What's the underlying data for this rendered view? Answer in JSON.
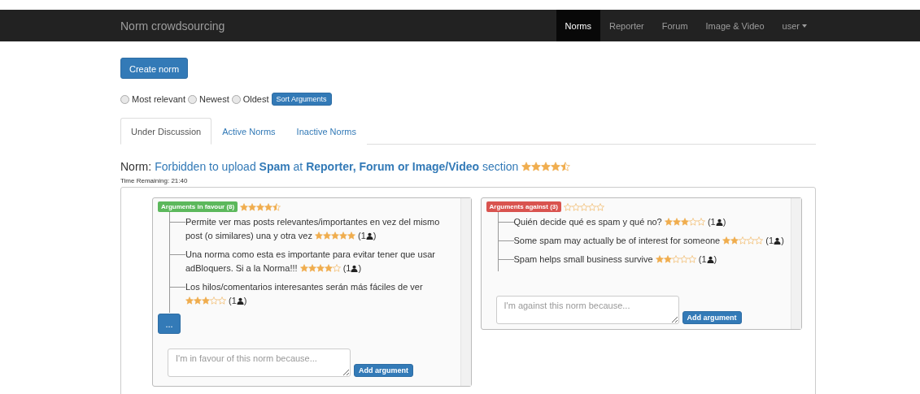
{
  "navbar": {
    "brand": "Norm crowdsourcing",
    "items": [
      {
        "label": "Norms",
        "selected": true
      },
      {
        "label": "Reporter",
        "selected": false
      },
      {
        "label": "Forum",
        "selected": false
      },
      {
        "label": "Image & Video",
        "selected": false
      }
    ],
    "user": "user"
  },
  "create_button": "Create norm",
  "sort": {
    "options": [
      {
        "label": "Most relevant",
        "selected": false
      },
      {
        "label": "Newest",
        "selected": false
      },
      {
        "label": "Oldest",
        "selected": false
      }
    ],
    "button": "Sort Arguments"
  },
  "tabs": [
    {
      "label": "Under Discussion",
      "selected": true
    },
    {
      "label": "Active Norms",
      "selected": false
    },
    {
      "label": "Inactive Norms",
      "selected": false
    }
  ],
  "norm": {
    "prefix": "Norm:",
    "title": "Forbidden to upload **Spam** at **Reporter, Forum or Image/Video** section",
    "stars": 4.5,
    "time_remaining": "Time Remaining: 21:40"
  },
  "columns": [
    {
      "kind": "favour",
      "badge": "Arguments in favour (8)",
      "stars": 4.5,
      "arguments": [
        {
          "text": "Permite ver mas posts relevantes/importantes en vez del mismo post (o similares) una y otra vez",
          "stars": 5,
          "votes": "(1",
          "votes_end": ")"
        },
        {
          "text": "Una norma como esta es importante para evitar tener que usar adBloquers. Si a la Norma!!!",
          "stars": 4,
          "votes": "(1",
          "votes_end": ")"
        },
        {
          "text": "Los hilos/comentarios interesantes serán más fáciles de ver",
          "stars": 3,
          "votes": "(1",
          "votes_end": ")"
        }
      ],
      "more_button": "...",
      "placeholder": "I'm in favour of this norm because...",
      "add_button": "Add argument"
    },
    {
      "kind": "against",
      "badge": "Arguments against (3)",
      "stars": 0,
      "arguments": [
        {
          "text": "Quién decide qué es spam y qué no?",
          "stars": 3,
          "votes": "(1",
          "votes_end": ")"
        },
        {
          "text": "Some spam may actually be of interest for someone",
          "stars": 2,
          "votes": "(1",
          "votes_end": ")"
        },
        {
          "text": "Spam helps small business survive",
          "stars": 2,
          "votes": "(1",
          "votes_end": ")"
        }
      ],
      "placeholder": "I'm against this norm because...",
      "add_button": "Add argument"
    }
  ]
}
